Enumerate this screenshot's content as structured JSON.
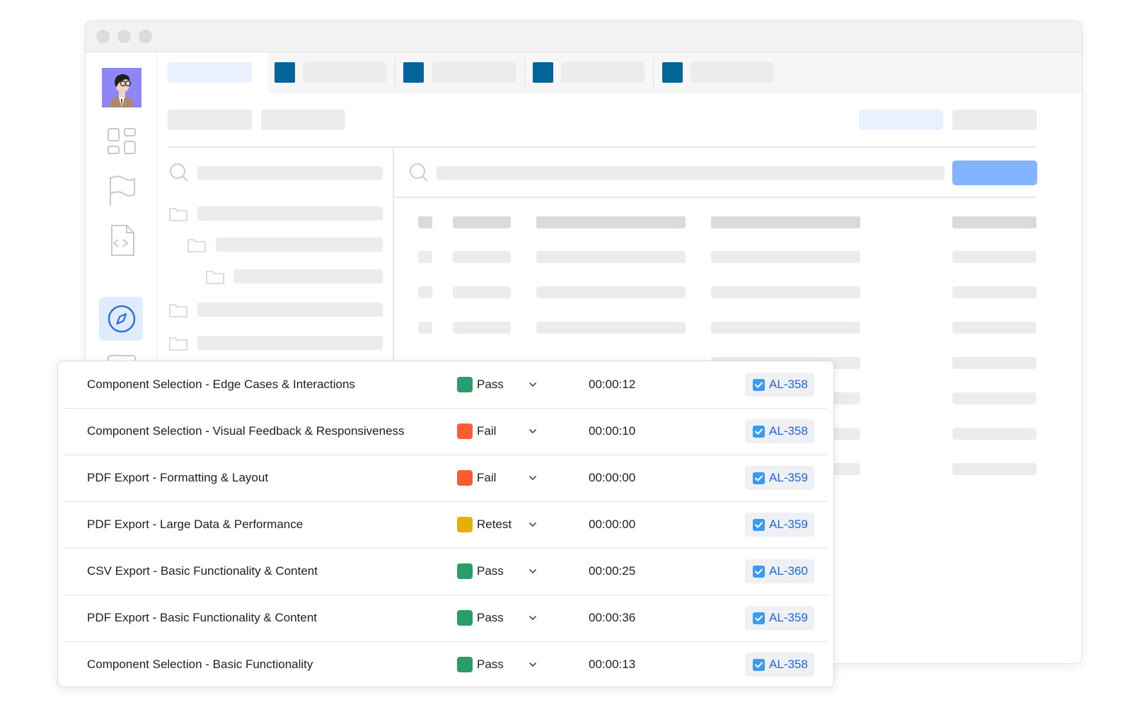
{
  "app": {
    "colors": {
      "accent": "#83b4ff",
      "tab_square": "#03659a",
      "pass": "#2a9e6a",
      "fail": "#f95d37",
      "retest": "#e6b000",
      "link": "#1e66d6",
      "check": "#3a9bf0"
    }
  },
  "sidebar": {
    "icons": [
      "dashboard-icon",
      "flag-icon",
      "code-file-icon",
      "compass-icon",
      "server-icon"
    ],
    "active": "compass-icon"
  },
  "test_runs": {
    "rows": [
      {
        "name": "Component Selection - Edge Cases & Interactions",
        "status": "Pass",
        "status_color": "#2a9e6a",
        "time": "00:00:12",
        "ticket": "AL-358"
      },
      {
        "name": "Component Selection - Visual Feedback & Responsiveness",
        "status": "Fail",
        "status_color": "#f95d37",
        "time": "00:00:10",
        "ticket": "AL-358"
      },
      {
        "name": "PDF Export - Formatting & Layout",
        "status": "Fail",
        "status_color": "#f95d37",
        "time": "00:00:00",
        "ticket": "AL-359"
      },
      {
        "name": "PDF Export - Large Data & Performance",
        "status": "Retest",
        "status_color": "#e6b000",
        "time": "00:00:00",
        "ticket": "AL-359"
      },
      {
        "name": "CSV Export - Basic Functionality & Content",
        "status": "Pass",
        "status_color": "#2a9e6a",
        "time": "00:00:25",
        "ticket": "AL-360"
      },
      {
        "name": "PDF Export - Basic Functionality & Content",
        "status": "Pass",
        "status_color": "#2a9e6a",
        "time": "00:00:36",
        "ticket": "AL-359"
      },
      {
        "name": "Component Selection - Basic Functionality",
        "status": "Pass",
        "status_color": "#2a9e6a",
        "time": "00:00:13",
        "ticket": "AL-358"
      }
    ]
  }
}
